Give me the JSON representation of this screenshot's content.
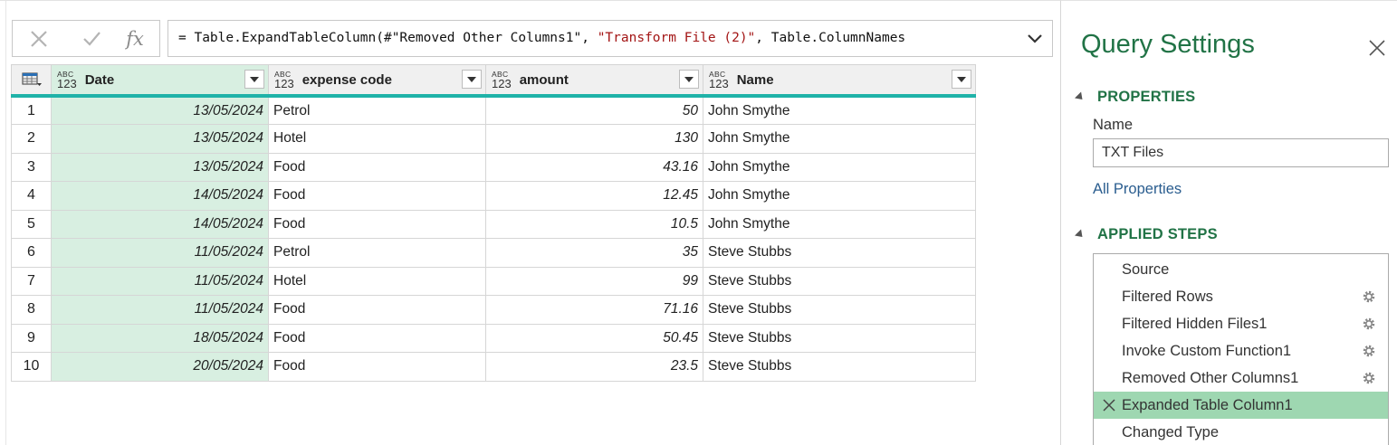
{
  "formula_bar": {
    "cancel_icon": "x-icon",
    "check_icon": "check-icon",
    "fx_label": "fx",
    "formula_prefix": "= Table.ExpandTableColumn(#\"Removed Other Columns1\", ",
    "formula_string": "\"Transform File (2)\"",
    "formula_suffix": ", Table.ColumnNames"
  },
  "table": {
    "columns": [
      {
        "type_top": "ABC",
        "type_bottom": "123",
        "label": "Date"
      },
      {
        "type_top": "ABC",
        "type_bottom": "123",
        "label": "expense code"
      },
      {
        "type_top": "ABC",
        "type_bottom": "123",
        "label": "amount"
      },
      {
        "type_top": "ABC",
        "type_bottom": "123",
        "label": "Name"
      }
    ],
    "rows": [
      {
        "n": "1",
        "date": "13/05/2024",
        "code": "Petrol",
        "amount": "50",
        "name": "John Smythe"
      },
      {
        "n": "2",
        "date": "13/05/2024",
        "code": "Hotel",
        "amount": "130",
        "name": "John Smythe"
      },
      {
        "n": "3",
        "date": "13/05/2024",
        "code": "Food",
        "amount": "43.16",
        "name": "John Smythe"
      },
      {
        "n": "4",
        "date": "14/05/2024",
        "code": "Food",
        "amount": "12.45",
        "name": "John Smythe"
      },
      {
        "n": "5",
        "date": "14/05/2024",
        "code": "Food",
        "amount": "10.5",
        "name": "John Smythe"
      },
      {
        "n": "6",
        "date": "11/05/2024",
        "code": "Petrol",
        "amount": "35",
        "name": "Steve Stubbs"
      },
      {
        "n": "7",
        "date": "11/05/2024",
        "code": "Hotel",
        "amount": "99",
        "name": "Steve Stubbs"
      },
      {
        "n": "8",
        "date": "11/05/2024",
        "code": "Food",
        "amount": "71.16",
        "name": "Steve Stubbs"
      },
      {
        "n": "9",
        "date": "18/05/2024",
        "code": "Food",
        "amount": "50.45",
        "name": "Steve Stubbs"
      },
      {
        "n": "10",
        "date": "20/05/2024",
        "code": "Food",
        "amount": "23.5",
        "name": "Steve Stubbs"
      }
    ]
  },
  "settings": {
    "title": "Query Settings",
    "properties_heading": "PROPERTIES",
    "name_label": "Name",
    "name_value": "TXT Files",
    "all_properties": "All Properties",
    "applied_steps_heading": "APPLIED STEPS",
    "steps": [
      {
        "label": "Source",
        "gear": false,
        "selected": false
      },
      {
        "label": "Filtered Rows",
        "gear": true,
        "selected": false
      },
      {
        "label": "Filtered Hidden Files1",
        "gear": true,
        "selected": false
      },
      {
        "label": "Invoke Custom Function1",
        "gear": true,
        "selected": false
      },
      {
        "label": "Removed Other Columns1",
        "gear": true,
        "selected": false
      },
      {
        "label": "Expanded Table Column1",
        "gear": false,
        "selected": true
      },
      {
        "label": "Changed Type",
        "gear": false,
        "selected": false
      }
    ]
  },
  "colors": {
    "accent_green": "#217346",
    "selected_step": "#9ed7b1",
    "date_column_bg": "#d8efe1",
    "header_underline": "#1fb2a8",
    "string_literal": "#a31515"
  }
}
